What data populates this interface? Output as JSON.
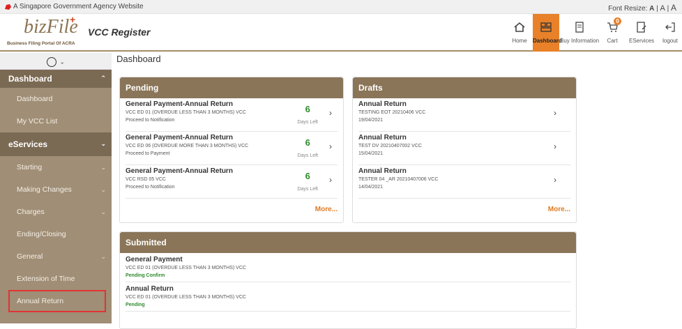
{
  "govbar": {
    "text": "A Singapore Government Agency Website",
    "font_resize_label": "Font Resize:",
    "font_sizes": [
      "A",
      "A",
      "A"
    ]
  },
  "header": {
    "logo_text": "bizFile",
    "logo_tagline": "Business Filing Portal Of ACRA",
    "app_title": "VCC Register",
    "nav": [
      {
        "label": "Home",
        "icon": "home-icon"
      },
      {
        "label": "Dashboard",
        "icon": "dashboard-icon",
        "active": true
      },
      {
        "label": "Buy Information",
        "icon": "document-icon"
      },
      {
        "label": "Cart",
        "icon": "cart-icon",
        "badge": "0"
      },
      {
        "label": "EServices",
        "icon": "edit-document-icon"
      },
      {
        "label": "logout",
        "icon": "logout-icon"
      }
    ],
    "accent_color": "#e8812a"
  },
  "sidebar": {
    "user_icon": "user-circle-icon",
    "dashboard_section": "Dashboard",
    "dashboard_items": [
      "Dashboard",
      "My VCC List"
    ],
    "eservices_section": "eServices",
    "eservices_items": [
      {
        "label": "Starting",
        "expandable": true
      },
      {
        "label": "Making Changes",
        "expandable": true
      },
      {
        "label": "Charges",
        "expandable": true
      },
      {
        "label": "Ending/Closing",
        "expandable": false
      },
      {
        "label": "General",
        "expandable": true
      },
      {
        "label": "Extension of Time",
        "expandable": false
      },
      {
        "label": "Annual Return",
        "expandable": false,
        "highlighted": true
      }
    ]
  },
  "main": {
    "page_title": "Dashboard",
    "pending": {
      "title": "Pending",
      "items": [
        {
          "title": "General Payment-Annual Return",
          "subtitle": "VCC ED 01 (OVERDUE LESS THAN 3 MONTHS) VCC",
          "status": "Proceed to Notification",
          "days": "6",
          "days_label": "Days Left"
        },
        {
          "title": "General Payment-Annual Return",
          "subtitle": "VCC ED 06 (OVERDUE MORE THAN 3 MONTHS) VCC",
          "status": "Proceed to Payment",
          "days": "6",
          "days_label": "Days Left"
        },
        {
          "title": "General Payment-Annual Return",
          "subtitle": "VCC RSD 05 VCC",
          "status": "Proceed to Notification",
          "days": "6",
          "days_label": "Days Left"
        }
      ],
      "more": "More..."
    },
    "drafts": {
      "title": "Drafts",
      "items": [
        {
          "title": "Annual Return",
          "subtitle": "TESTING EOT 20210406 VCC",
          "date": "19/04/2021"
        },
        {
          "title": "Annual Return",
          "subtitle": "TEST DV 20210407002 VCC",
          "date": "15/04/2021"
        },
        {
          "title": "Annual Return",
          "subtitle": "TESTER 04 _AR 20210407006 VCC",
          "date": "14/04/2021"
        }
      ],
      "more": "More..."
    },
    "submitted": {
      "title": "Submitted",
      "items": [
        {
          "title": "General Payment",
          "subtitle": "VCC ED 01 (OVERDUE LESS THAN 3 MONTHS) VCC",
          "status": "Pending Confirm"
        },
        {
          "title": "Annual Return",
          "subtitle": "VCC ED 01 (OVERDUE LESS THAN 3 MONTHS) VCC",
          "status": "Pending"
        }
      ]
    }
  }
}
